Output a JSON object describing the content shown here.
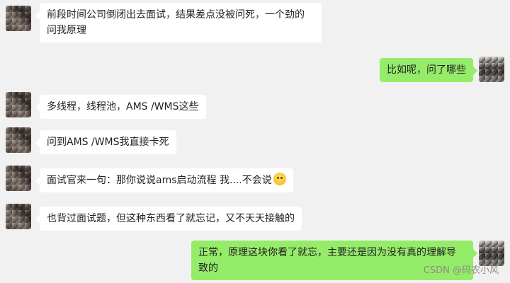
{
  "messages": [
    {
      "side": "left",
      "text_line1": "前段时间公司倒闭出去面试，结果差点没被问死，一个劲的",
      "text_line2": "问我原理"
    },
    {
      "side": "right",
      "text": "比如呢，问了哪些"
    },
    {
      "side": "left",
      "text": "多线程，线程池，AMS /WMS这些"
    },
    {
      "side": "left",
      "text": "问到AMS /WMS我直接卡死"
    },
    {
      "side": "left",
      "text": "面试官来一句：那你说说ams启动流程  我....不会说",
      "emoji": "zipper-mouth-face"
    },
    {
      "side": "left",
      "text": "也背过面试题，但这种东西看了就忘记，又不天天接触的"
    },
    {
      "side": "right",
      "text_line1": "正常，原理这块你看了就忘，主要还是因为没有真的理解导",
      "text_line2": "致的"
    }
  ],
  "watermark": "CSDN @码农小风",
  "colors": {
    "background": "#f1f1f1",
    "left_bubble": "#ffffff",
    "right_bubble": "#95ec69"
  }
}
